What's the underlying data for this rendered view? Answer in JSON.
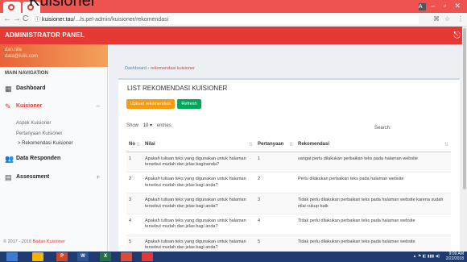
{
  "caption": "Kuisioner",
  "browser": {
    "url_host": "kuisioner.tau",
    "url_path": "/.../s.pel-admin/kuisioner/rekomendasi",
    "nav_back": "←",
    "nav_forward": "→",
    "nav_reload": "C"
  },
  "header": {
    "brand": "ADMINISTRATOR PANEL",
    "logout_glyph": "⎋"
  },
  "sidebar": {
    "user_line1": "dan.nila",
    "user_line2": "data@lulis.com",
    "section_label": "MAIN NAVIGATION",
    "items": [
      {
        "label": "Dashboard",
        "icon": "dashboard-icon"
      },
      {
        "label": "Kuisioner",
        "icon": "pencil-icon"
      },
      {
        "label": "Data Responden",
        "icon": "users-icon"
      },
      {
        "label": "Assessment",
        "icon": "list-icon"
      }
    ],
    "sub_items": [
      "Aspek Kuisioner",
      "Pertanyaan Kuisioner",
      "Rekomendasi Kuisioner"
    ],
    "copyright": "© 2017 - 2018",
    "copyright_link": "Badan Kuisioner"
  },
  "breadcrumb": {
    "home": "Dashboard",
    "current": "rekomendasi kuisioner"
  },
  "box": {
    "title": "LIST REKOMENDASI KUISIONER",
    "upload_label": "Upload rekomendasi",
    "refresh_label": "Refresh",
    "show_label": "Show",
    "show_value": "10",
    "entries_label": "entries",
    "search_label": "Search:"
  },
  "table": {
    "headers": [
      "No",
      "Nilai",
      "Pertanyaan",
      "Rekomendasi"
    ],
    "rows": [
      {
        "no": "1",
        "nilai": "Apakah tulisan teks yang digunakan untuk halaman tersebut mudah dan jelas baginanda?",
        "pertanyaan": "1",
        "rekomendasi": "sangat perlu dilakukan perbaikan teks pada halaman website"
      },
      {
        "no": "2",
        "nilai": "Apakah tulisan teks yang digunakan untuk halaman tersebut mudah dan jelas bagi anda?",
        "pertanyaan": "2",
        "rekomendasi": "Perlu dilakukan perbaikan teks pada halaman website"
      },
      {
        "no": "3",
        "nilai": "Apakah tulisan teks yang digunakan untuk halaman tersebut mudah dan jelas bagi anda?",
        "pertanyaan": "3",
        "rekomendasi": "Tidak perlu dilakukan perbaikan teks pada halaman website karena sudah nilai cukup baik"
      },
      {
        "no": "4",
        "nilai": "Apakah tulisan teks yang digunakan untuk halaman tersebut mudah dan jelas bagi anda?",
        "pertanyaan": "4",
        "rekomendasi": "Tidak perlu dilakukan perbaikan teks pada halaman website"
      },
      {
        "no": "5",
        "nilai": "Apakah tulisan teks yang digunakan untuk halaman tersebut mudah dan jelas bagi anda?",
        "pertanyaan": "5",
        "rekomendasi": "Tidak perlu dilakukan perbaikan teks pada halaman website"
      }
    ]
  },
  "taskbar": {
    "items": [
      {
        "label": "",
        "color": "#3d7bd6",
        "icon": "start-icon"
      },
      {
        "label": "",
        "color": "#f5b400",
        "icon": "folder-icon"
      },
      {
        "label": "P",
        "color": "#d24726",
        "icon": "powerpoint-icon"
      },
      {
        "label": "W",
        "color": "#2b579a",
        "icon": "word-icon"
      },
      {
        "label": "X",
        "color": "#217346",
        "icon": "excel-icon"
      },
      {
        "label": "",
        "color": "#dd4b39",
        "icon": "chrome-icon"
      },
      {
        "label": "",
        "color": "#e53935",
        "icon": "app-icon"
      }
    ],
    "time": "9:09 AM",
    "date": "2/22/2018"
  },
  "colors": {
    "accent": "#e53935",
    "upload": "#f39c12",
    "refresh": "#00a65a",
    "taskbar": "#1f3a6e"
  }
}
